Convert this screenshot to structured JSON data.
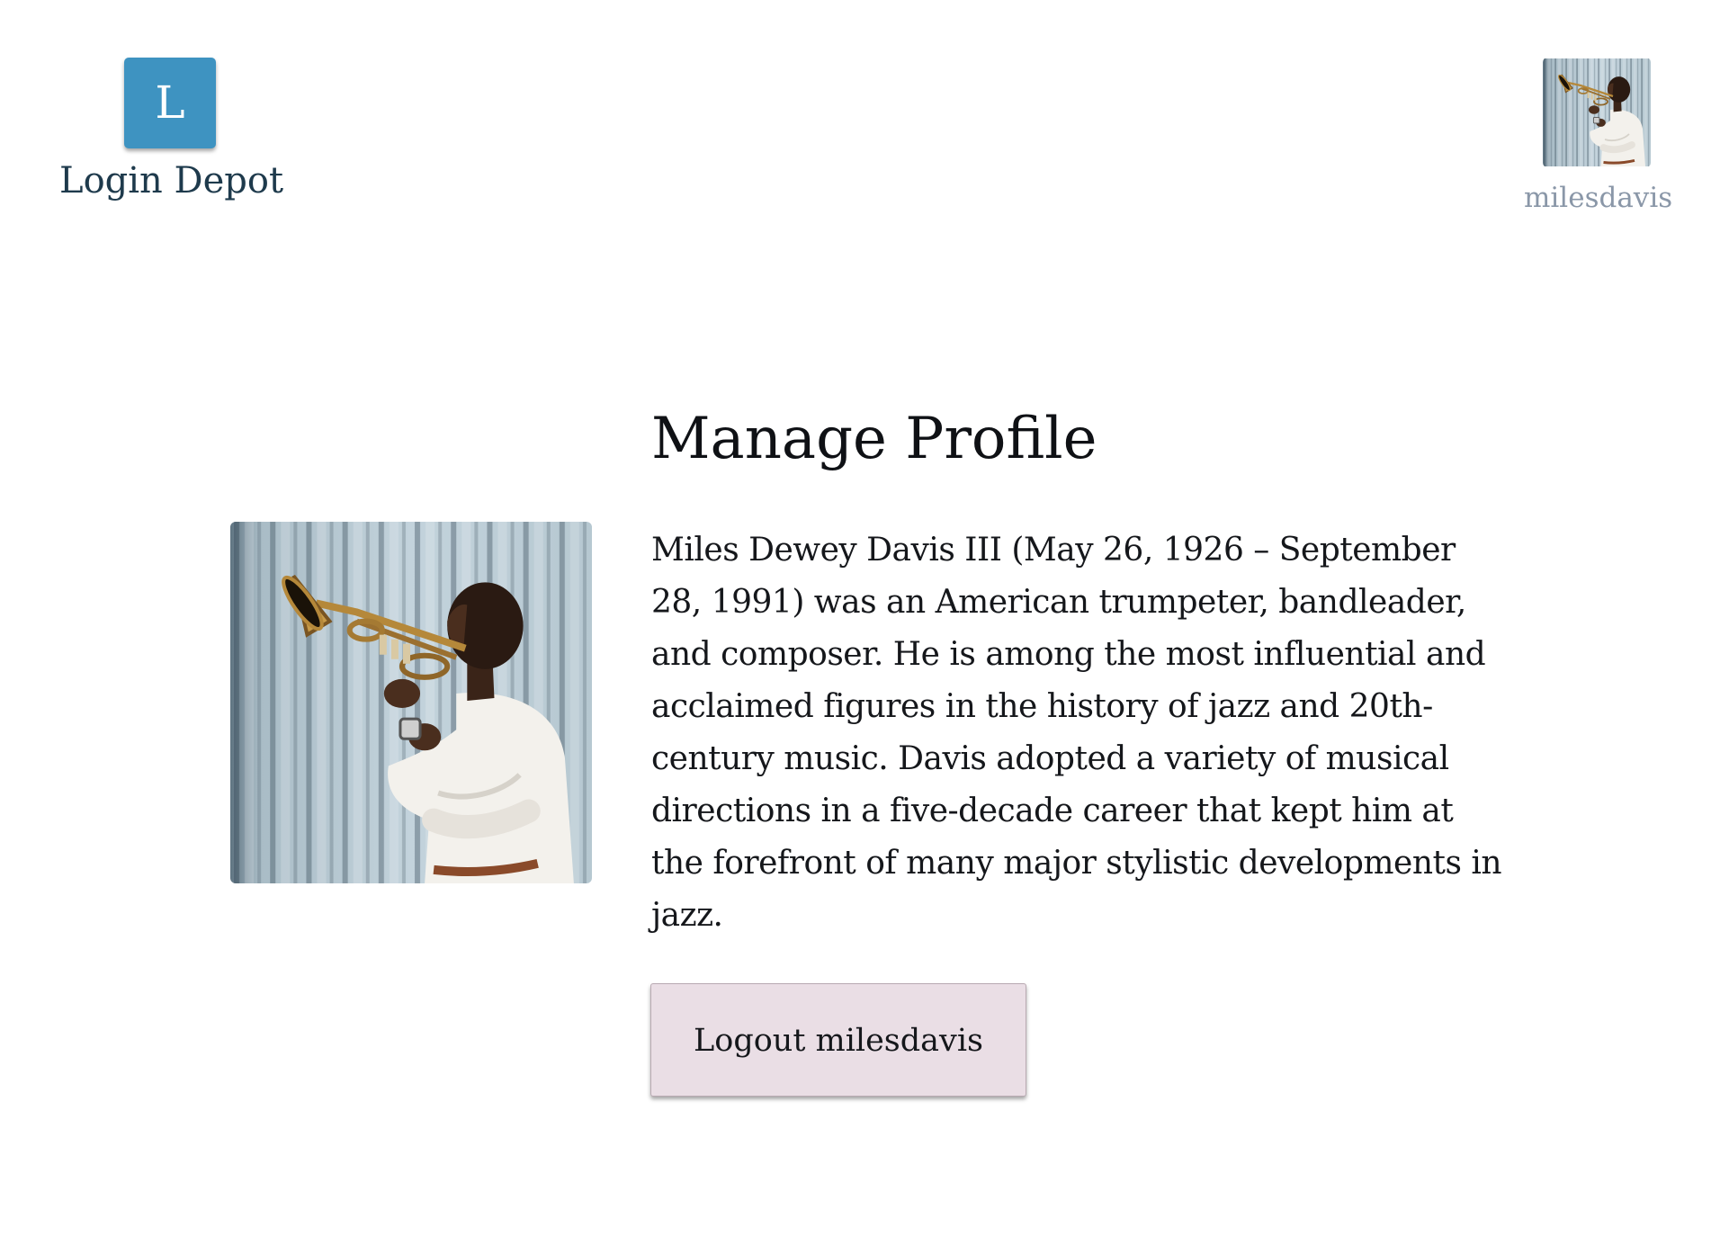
{
  "header": {
    "logo": {
      "letter": "L",
      "name": "Login Depot",
      "badge_color": "#3e93c1"
    },
    "user": {
      "username": "milesdavis",
      "avatar_icon": "profile-photo"
    }
  },
  "main": {
    "title": "Manage Profile",
    "portrait_icon": "trumpet-player-photo",
    "bio": "Miles Dewey Davis III (May 26, 1926 – September 28, 1991) was an American trumpeter, bandleader, and composer. He is among the most influential and acclaimed figures in the history of jazz and 20th-century music. Davis adopted a variety of musical directions in a five-decade career that kept him at the forefront of many major stylistic developments in jazz.",
    "logout_label": "Logout milesdavis",
    "logout_color": "#eadee5"
  }
}
